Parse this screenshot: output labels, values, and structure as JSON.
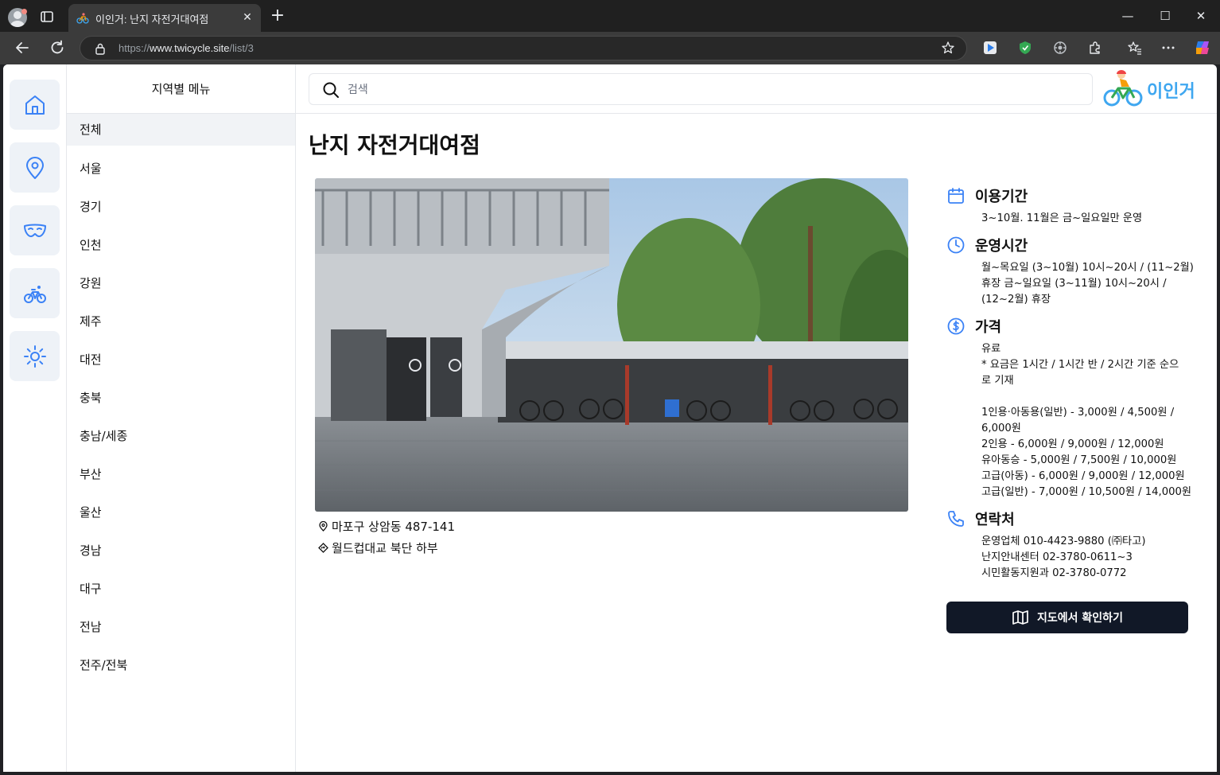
{
  "browser": {
    "tab_title": "이인거: 난지 자전거대여점",
    "url_prefix": "https://",
    "url_host": "www.twicycle.site",
    "url_path": "/list/3",
    "new_tab_label": "+",
    "close_tab_label": "✕",
    "window_minimize": "—",
    "window_maximize": "☐",
    "window_close": "✕"
  },
  "rail": {
    "items": [
      {
        "icon": "home-icon"
      },
      {
        "icon": "location-pin-icon"
      },
      {
        "icon": "mask-icon"
      },
      {
        "icon": "bicycle-icon"
      },
      {
        "icon": "sun-icon"
      }
    ]
  },
  "region_menu": {
    "title": "지역별 메뉴",
    "items": [
      "전체",
      "서울",
      "경기",
      "인천",
      "강원",
      "제주",
      "대전",
      "충북",
      "충남/세종",
      "부산",
      "울산",
      "경남",
      "대구",
      "전남",
      "전주/전북"
    ],
    "active_index": 0
  },
  "search": {
    "placeholder": "검색"
  },
  "logo": {
    "text": "이인거"
  },
  "shop": {
    "name": "난지 자전거대여점",
    "address": "마포구 상암동 487-141",
    "location_note": "월드컵대교 북단 하부",
    "sections": [
      {
        "icon": "calendar-icon",
        "title": "이용기간",
        "body": "3~10월. 11월은 금~일요일만 운영"
      },
      {
        "icon": "clock-icon",
        "title": "운영시간",
        "body": "월~목요일 (3~10월) 10시~20시 / (11~2월)\n휴장 금~일요일 (3~11월) 10시~20시 /\n(12~2월) 휴장"
      },
      {
        "icon": "dollar-icon",
        "title": "가격",
        "body": "유료\n* 요금은 1시간 / 1시간 반 / 2시간 기준 순으\n로 기재\n\n1인용·아동용(일반) - 3,000원 / 4,500원 /\n6,000원\n2인용 - 6,000원 / 9,000원 / 12,000원\n유아동승 - 5,000원 / 7,500원 / 10,000원\n고급(아동) - 6,000원 / 9,000원 / 12,000원\n고급(일반) - 7,000원 / 10,500원 / 14,000원"
      },
      {
        "icon": "phone-icon",
        "title": "연락처",
        "body": "운영업체 010-4423-9880 (㈜타고)\n난지안내센터 02-3780-0611~3\n시민활동지원과 02-3780-0772"
      }
    ],
    "map_button": "지도에서 확인하기"
  },
  "colors": {
    "accent": "#3b82f6",
    "button_dark": "#111827",
    "logo_blue": "#3fa7f0"
  }
}
